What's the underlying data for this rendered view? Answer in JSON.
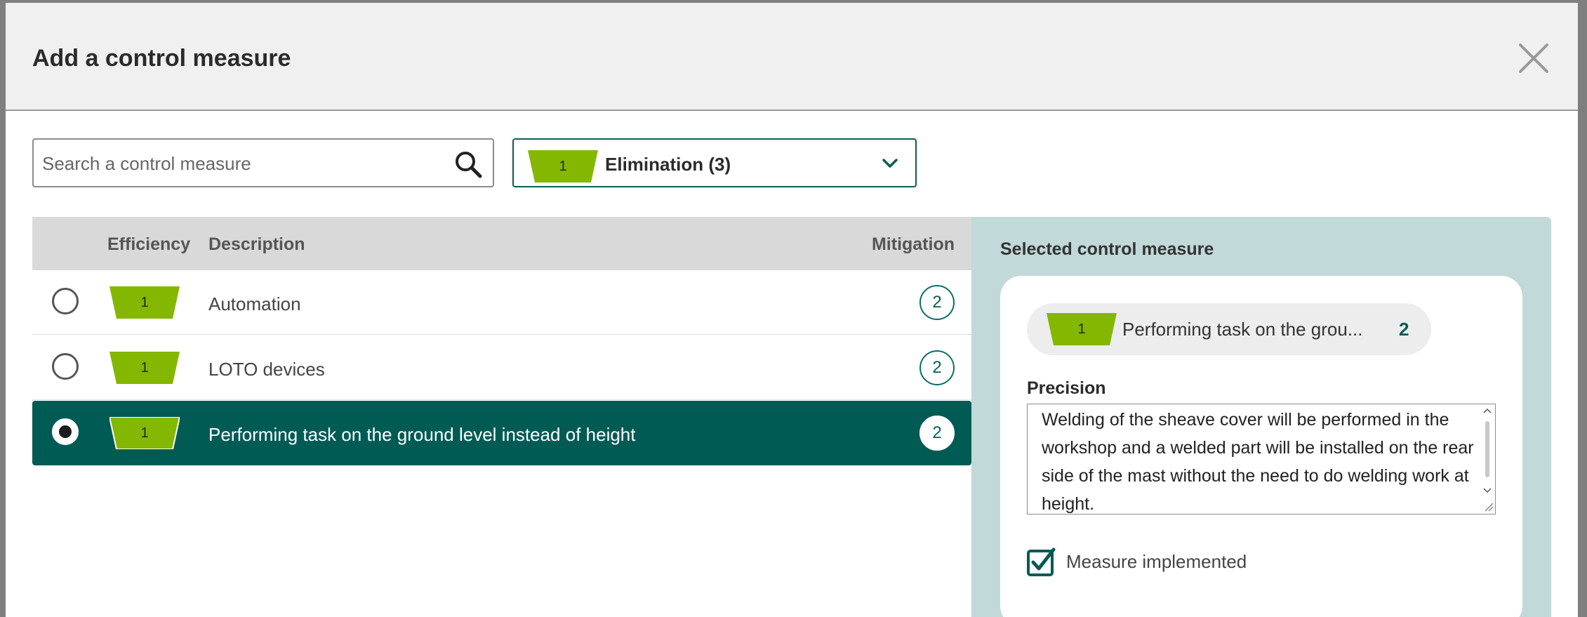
{
  "modal": {
    "title": "Add a control measure",
    "close_icon": "close-icon"
  },
  "search": {
    "placeholder": "Search a control measure",
    "value": ""
  },
  "filter": {
    "badge": "1",
    "label": "Elimination (3)"
  },
  "table": {
    "headers": {
      "efficiency": "Efficiency",
      "description": "Description",
      "mitigation": "Mitigation"
    },
    "rows": [
      {
        "efficiency": "1",
        "description": "Automation",
        "mitigation": "2",
        "selected": false
      },
      {
        "efficiency": "1",
        "description": "LOTO devices",
        "mitigation": "2",
        "selected": false
      },
      {
        "efficiency": "1",
        "description": "Performing task on the ground level instead of height",
        "mitigation": "2",
        "selected": true
      }
    ]
  },
  "selected": {
    "title": "Selected control measure",
    "badge": "1",
    "label": "Performing task on the grou...",
    "count": "2",
    "precision_label": "Precision",
    "precision_text": "Welding of the sheave cover will be performed in the workshop and a welded part will be installed on the rear side of the mast without the need to do welding work at height.",
    "implemented_label": "Measure implemented",
    "implemented": true
  },
  "colors": {
    "primary": "#005b55",
    "badge_green": "#84b700",
    "panel": "#c2d9d9"
  }
}
